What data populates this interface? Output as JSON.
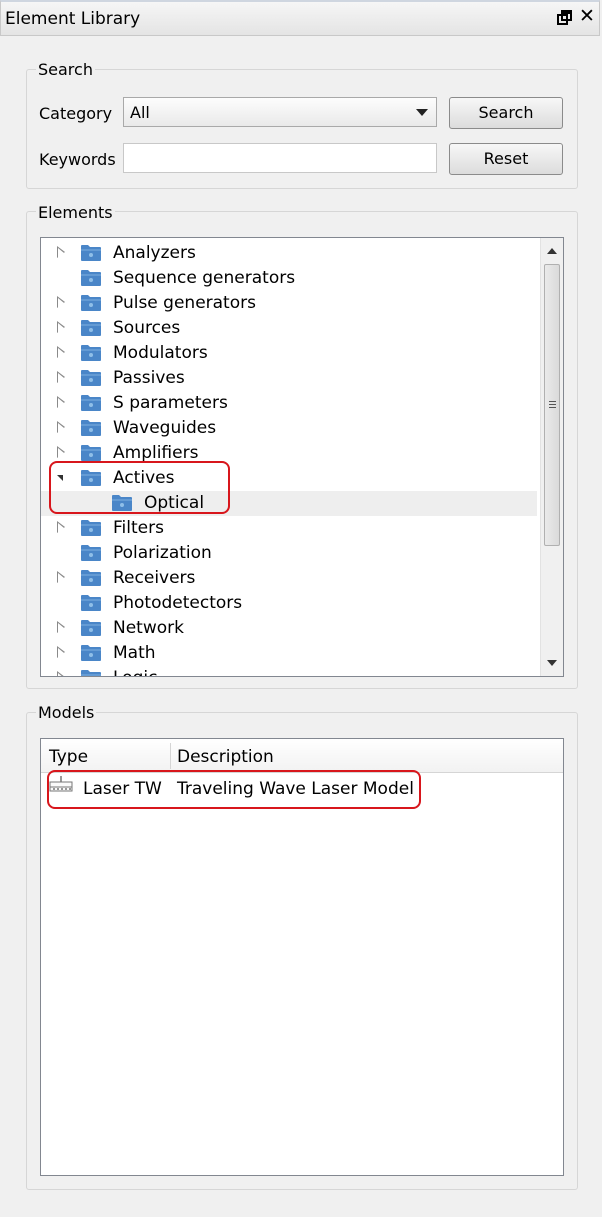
{
  "window": {
    "title": "Element Library",
    "float_icon": "float-icon",
    "close_icon": "close-icon",
    "close_glyph": "✕"
  },
  "search": {
    "group_title": "Search",
    "category_label": "Category",
    "category_value": "All",
    "keywords_label": "Keywords",
    "keywords_value": "",
    "search_button": "Search",
    "reset_button": "Reset"
  },
  "elements": {
    "group_title": "Elements",
    "items": [
      {
        "label": "Analyzers",
        "expandable": true
      },
      {
        "label": "Sequence generators",
        "expandable": false
      },
      {
        "label": "Pulse generators",
        "expandable": true
      },
      {
        "label": "Sources",
        "expandable": true
      },
      {
        "label": "Modulators",
        "expandable": true
      },
      {
        "label": "Passives",
        "expandable": true
      },
      {
        "label": "S parameters",
        "expandable": true
      },
      {
        "label": "Waveguides",
        "expandable": true
      },
      {
        "label": "Amplifiers",
        "expandable": true
      },
      {
        "label": "Actives",
        "expandable": true,
        "expanded": true
      },
      {
        "label": "Optical",
        "expandable": false,
        "child": true,
        "selected": true
      },
      {
        "label": "Filters",
        "expandable": true
      },
      {
        "label": "Polarization",
        "expandable": false
      },
      {
        "label": "Receivers",
        "expandable": true
      },
      {
        "label": "Photodetectors",
        "expandable": false
      },
      {
        "label": "Network",
        "expandable": true
      },
      {
        "label": "Math",
        "expandable": true
      },
      {
        "label": "Logic",
        "expandable": true
      }
    ]
  },
  "models": {
    "group_title": "Models",
    "columns": [
      "Type",
      "Description"
    ],
    "rows": [
      {
        "type": "Laser TW",
        "description": "Traveling Wave Laser Model",
        "icon": "laser-model-icon"
      }
    ]
  },
  "colors": {
    "folder": "#4a86c8",
    "highlight": "#d8161c",
    "selection": "#eeeeee"
  }
}
